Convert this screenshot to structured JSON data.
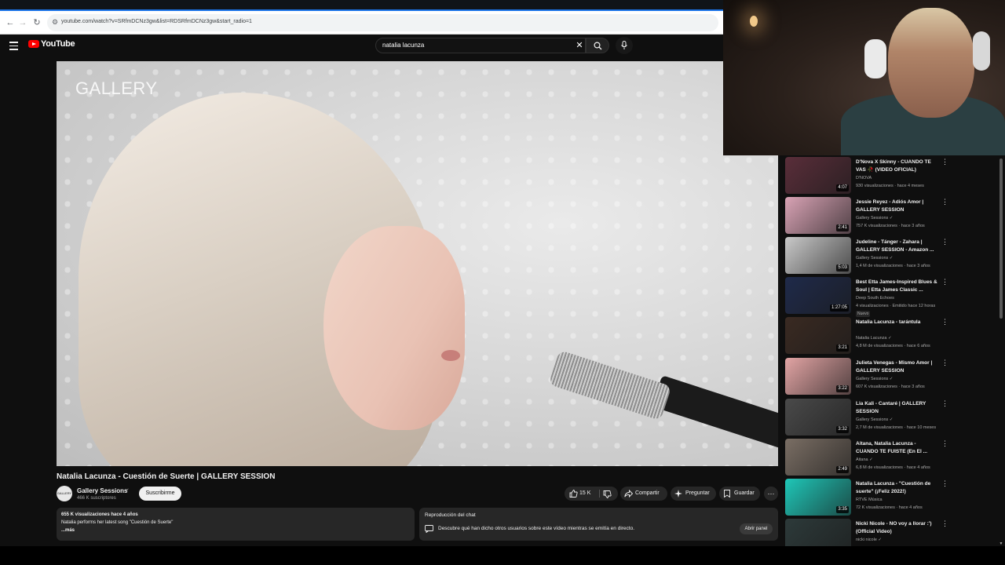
{
  "browser": {
    "url": "youtube.com/watch?v=SRfmDCNz3gw&list=RDSRfmDCNz3gw&start_radio=1"
  },
  "header": {
    "logo_text": "YouTube",
    "search_value": "natalia lacunza",
    "clear_glyph": "✕"
  },
  "player": {
    "watermark": "GALLERY"
  },
  "video": {
    "title": "Natalia Lacunza - Cuestión de Suerte | GALLERY SESSION",
    "channel": {
      "avatar_text": "GALLERY",
      "name": "Gallery Sessions",
      "verified_glyph": "✓",
      "subscribers": "466 K suscriptores"
    },
    "subscribe_label": "Suscribirme",
    "actions": {
      "likes": "15 K",
      "share": "Compartir",
      "ask": "Preguntar",
      "save": "Guardar",
      "more": "⋯"
    },
    "description": {
      "stats": "655 K visualizaciones  hace 4 años",
      "text": "Natalia performs her latest song \"Cuestión de Suerte\"",
      "more": "...más"
    },
    "chat": {
      "title": "Reproducción del chat",
      "description": "Descubre qué han dicho otros usuarios sobre este vídeo mientras se emitía en directo.",
      "open_label": "Abrir panel"
    }
  },
  "recommendations": [
    {
      "title": "D'Nova X Skinny - CUANDO TE VAS 🥀 (VIDEO OFICIAL)",
      "channel": "D'NOVA",
      "meta": "930 visualizaciones · hace 4 meses",
      "duration": "4:07",
      "thumb_color": "#5a2e3a"
    },
    {
      "title": "Jessie Reyez - Adiós Amor | GALLERY SESSION",
      "channel": "Gallery Sessions ✓",
      "meta": "757 K visualizaciones · hace 3 años",
      "duration": "2:41",
      "thumb_color": "#d9a3b5"
    },
    {
      "title": "Judeline - Tánger - Zahara | GALLERY SESSION - Amazon ...",
      "channel": "Gallery Sessions ✓",
      "meta": "1,4 M de visualizaciones · hace 3 años",
      "duration": "5:03",
      "thumb_color": "#c9c9c9"
    },
    {
      "title": "Best Etta James-Inspired Blues & Soul | Etta James Classic ...",
      "channel": "Deep South Echoes",
      "meta": "4 visualizaciones · Emitido hace 12 horas",
      "badge": "Nuevo",
      "duration": "1:27:05",
      "thumb_color": "#1f2a4a"
    },
    {
      "title": "Natalia Lacunza - tarántula",
      "channel": "Natalia Lacunza ✓",
      "meta": "4,8 M de visualizaciones · hace 6 años",
      "duration": "3:21",
      "thumb_color": "#3a2a22"
    },
    {
      "title": "Julieta Venegas - Mismo Amor | GALLERY SESSION",
      "channel": "Gallery Sessions ✓",
      "meta": "607 K visualizaciones · hace 3 años",
      "duration": "3:22",
      "thumb_color": "#e2a4a4"
    },
    {
      "title": "Lia Kali - Cantaré | GALLERY SESSION",
      "channel": "Gallery Sessions ✓",
      "meta": "2,7 M de visualizaciones · hace 10 meses",
      "duration": "3:32",
      "thumb_color": "#4a4a4a"
    },
    {
      "title": "Aitana, Natalia Lacunza - CUANDO TE FUISTE (En El ...",
      "channel": "Aitana ✓",
      "meta": "6,8 M de visualizaciones · hace 4 años",
      "duration": "2:49",
      "thumb_color": "#7a6e64"
    },
    {
      "title": "Natalia Lacunza - \"Cuestión de suerte\" (¡Feliz 2022!)",
      "channel": "RTVE Música",
      "meta": "72 K visualizaciones · hace 4 años",
      "duration": "3:35",
      "thumb_color": "#1fc7b8"
    },
    {
      "title": "Nicki Nicole - NO voy a llorar :') (Official Video)",
      "channel": "nicki nicole ✓",
      "meta": "",
      "duration": "",
      "thumb_color": "#2d3a3a"
    }
  ]
}
